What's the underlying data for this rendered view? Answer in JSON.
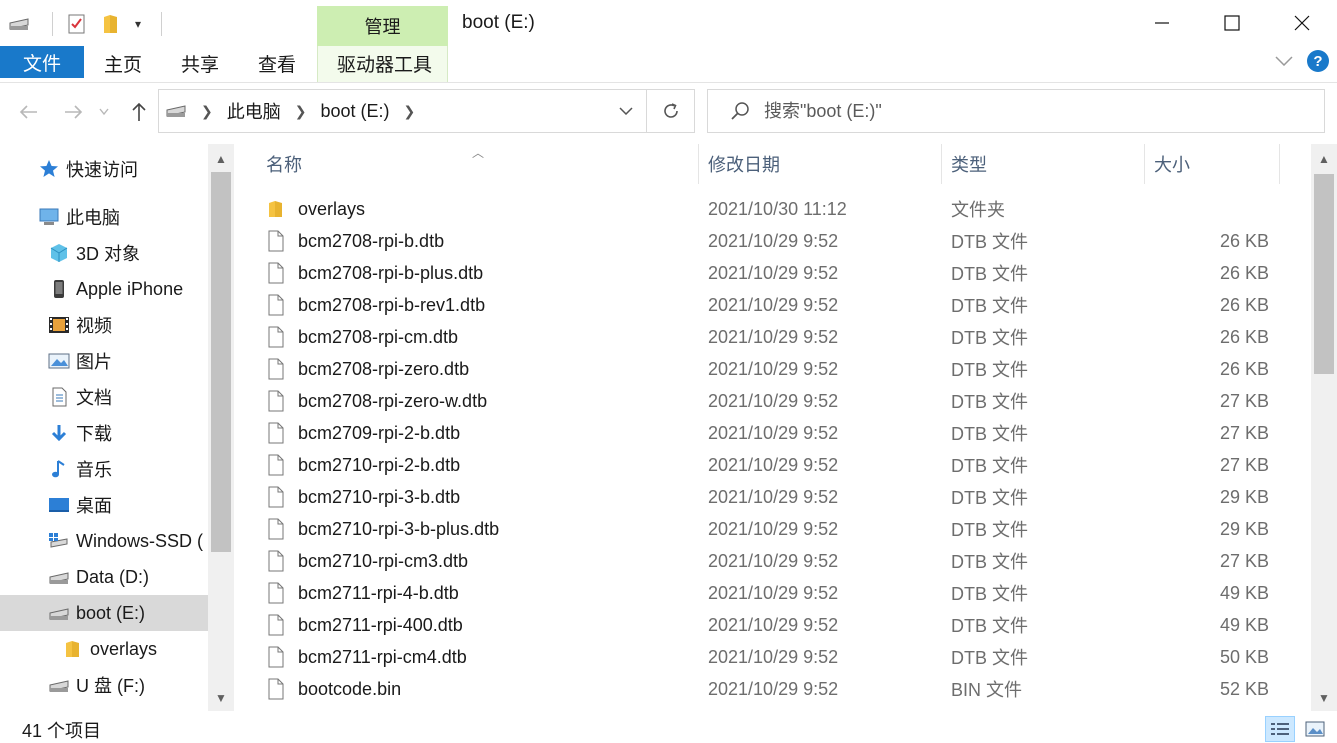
{
  "window": {
    "title": "boot (E:)",
    "manage_tab_label": "管理",
    "minimize_glyph": "—",
    "maximize_glyph": "☐",
    "close_glyph": "✕"
  },
  "ribbon": {
    "tabs": {
      "file": "文件",
      "home": "主页",
      "share": "共享",
      "view": "查看",
      "drive_tools": "驱动器工具"
    }
  },
  "address": {
    "crumbs": [
      "此电脑",
      "boot (E:)"
    ],
    "search_placeholder": "搜索\"boot (E:)\""
  },
  "nav_pane": {
    "items": [
      {
        "label": "快速访问",
        "icon": "star-icon"
      },
      {
        "label": "此电脑",
        "icon": "computer-icon"
      },
      {
        "label": "3D 对象",
        "icon": "cube-icon"
      },
      {
        "label": "Apple iPhone",
        "icon": "phone-icon"
      },
      {
        "label": "视频",
        "icon": "film-icon"
      },
      {
        "label": "图片",
        "icon": "picture-icon"
      },
      {
        "label": "文档",
        "icon": "document-icon"
      },
      {
        "label": "下载",
        "icon": "download-icon"
      },
      {
        "label": "音乐",
        "icon": "music-icon"
      },
      {
        "label": "桌面",
        "icon": "desktop-icon"
      },
      {
        "label": "Windows-SSD (",
        "icon": "windows-drive-icon"
      },
      {
        "label": "Data (D:)",
        "icon": "drive-icon"
      },
      {
        "label": "boot (E:)",
        "icon": "drive-icon",
        "selected": true
      },
      {
        "label": "overlays",
        "icon": "folder-icon"
      },
      {
        "label": "U 盘 (F:)",
        "icon": "drive-icon"
      }
    ]
  },
  "file_list": {
    "columns": {
      "name": "名称",
      "date": "修改日期",
      "type": "类型",
      "size": "大小"
    },
    "rows": [
      {
        "name": "overlays",
        "date": "2021/10/30 11:12",
        "type": "文件夹",
        "size": "",
        "kind": "folder"
      },
      {
        "name": "bcm2708-rpi-b.dtb",
        "date": "2021/10/29 9:52",
        "type": "DTB 文件",
        "size": "26 KB",
        "kind": "file"
      },
      {
        "name": "bcm2708-rpi-b-plus.dtb",
        "date": "2021/10/29 9:52",
        "type": "DTB 文件",
        "size": "26 KB",
        "kind": "file"
      },
      {
        "name": "bcm2708-rpi-b-rev1.dtb",
        "date": "2021/10/29 9:52",
        "type": "DTB 文件",
        "size": "26 KB",
        "kind": "file"
      },
      {
        "name": "bcm2708-rpi-cm.dtb",
        "date": "2021/10/29 9:52",
        "type": "DTB 文件",
        "size": "26 KB",
        "kind": "file"
      },
      {
        "name": "bcm2708-rpi-zero.dtb",
        "date": "2021/10/29 9:52",
        "type": "DTB 文件",
        "size": "26 KB",
        "kind": "file"
      },
      {
        "name": "bcm2708-rpi-zero-w.dtb",
        "date": "2021/10/29 9:52",
        "type": "DTB 文件",
        "size": "27 KB",
        "kind": "file"
      },
      {
        "name": "bcm2709-rpi-2-b.dtb",
        "date": "2021/10/29 9:52",
        "type": "DTB 文件",
        "size": "27 KB",
        "kind": "file"
      },
      {
        "name": "bcm2710-rpi-2-b.dtb",
        "date": "2021/10/29 9:52",
        "type": "DTB 文件",
        "size": "27 KB",
        "kind": "file"
      },
      {
        "name": "bcm2710-rpi-3-b.dtb",
        "date": "2021/10/29 9:52",
        "type": "DTB 文件",
        "size": "29 KB",
        "kind": "file"
      },
      {
        "name": "bcm2710-rpi-3-b-plus.dtb",
        "date": "2021/10/29 9:52",
        "type": "DTB 文件",
        "size": "29 KB",
        "kind": "file"
      },
      {
        "name": "bcm2710-rpi-cm3.dtb",
        "date": "2021/10/29 9:52",
        "type": "DTB 文件",
        "size": "27 KB",
        "kind": "file"
      },
      {
        "name": "bcm2711-rpi-4-b.dtb",
        "date": "2021/10/29 9:52",
        "type": "DTB 文件",
        "size": "49 KB",
        "kind": "file"
      },
      {
        "name": "bcm2711-rpi-400.dtb",
        "date": "2021/10/29 9:52",
        "type": "DTB 文件",
        "size": "49 KB",
        "kind": "file"
      },
      {
        "name": "bcm2711-rpi-cm4.dtb",
        "date": "2021/10/29 9:52",
        "type": "DTB 文件",
        "size": "50 KB",
        "kind": "file"
      },
      {
        "name": "bootcode.bin",
        "date": "2021/10/29 9:52",
        "type": "BIN 文件",
        "size": "52 KB",
        "kind": "file"
      }
    ]
  },
  "status": {
    "item_count": "41 个项目"
  },
  "colors": {
    "accent": "#1979ca",
    "manage_tab": "#cdeeb2",
    "selected_nav": "#d9d9d9",
    "header_text": "#4c607a"
  }
}
